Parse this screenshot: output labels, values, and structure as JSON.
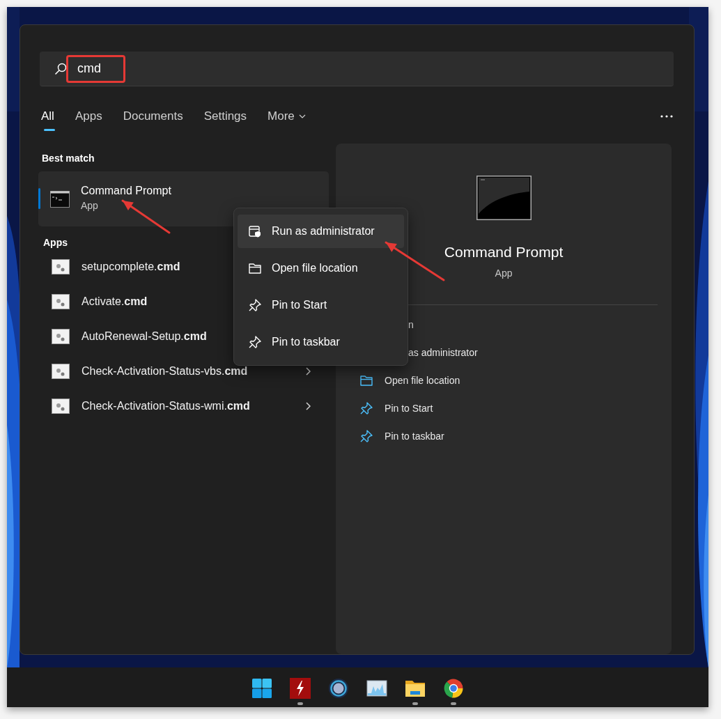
{
  "search": {
    "value": "cmd"
  },
  "tabs": [
    {
      "label": "All",
      "selected": true,
      "kind": "filter"
    },
    {
      "label": "Apps",
      "selected": false,
      "kind": "filter"
    },
    {
      "label": "Documents",
      "selected": false,
      "kind": "filter"
    },
    {
      "label": "Settings",
      "selected": false,
      "kind": "filter"
    },
    {
      "label": "More",
      "selected": false,
      "kind": "dropdown"
    }
  ],
  "best_match": {
    "heading": "Best match",
    "item": {
      "title": "Command Prompt",
      "subtitle": "App",
      "selected": true
    }
  },
  "apps": {
    "heading": "Apps",
    "items": [
      {
        "label": "setupcomplete.**cmd**"
      },
      {
        "label": "Activate.**cmd**"
      },
      {
        "label": "AutoRenewal-Setup.**cmd**"
      },
      {
        "label": "Check-Activation-Status-vbs.**cmd**",
        "expandable": true
      },
      {
        "label": "Check-Activation-Status-wmi.**cmd**",
        "expandable": true
      }
    ]
  },
  "context_menu": {
    "items": [
      {
        "label": "Run as administrator",
        "kind": "admin",
        "highlighted": true
      },
      {
        "label": "Open file location",
        "kind": "folder",
        "highlighted": false
      },
      {
        "label": "Pin to Start",
        "kind": "pin",
        "highlighted": false
      },
      {
        "label": "Pin to taskbar",
        "kind": "pin",
        "highlighted": false
      }
    ]
  },
  "details": {
    "title": "Command Prompt",
    "subtitle": "App",
    "actions": [
      {
        "label": "n",
        "kind": "covered"
      },
      {
        "label": "as administrator",
        "kind": "covered"
      },
      {
        "label": "Open file location",
        "kind": "folder"
      },
      {
        "label": "Pin to Start",
        "kind": "pin"
      },
      {
        "label": "Pin to taskbar",
        "kind": "pin"
      }
    ]
  },
  "taskbar": {
    "items": [
      {
        "kind": "start",
        "running": false
      },
      {
        "kind": "bolt",
        "running": true
      },
      {
        "kind": "ring",
        "running": false
      },
      {
        "kind": "monitor",
        "running": false
      },
      {
        "kind": "folder",
        "running": true
      },
      {
        "kind": "browser",
        "running": true
      }
    ]
  }
}
